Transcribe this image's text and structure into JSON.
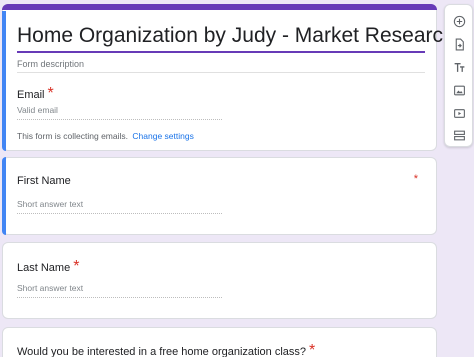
{
  "form": {
    "title": "Home Organization by Judy - Market Research",
    "description_placeholder": "Form description"
  },
  "email_section": {
    "label": "Email",
    "required_mark": "*",
    "placeholder": "Valid email",
    "note": "This form is collecting emails.",
    "change_link": "Change settings"
  },
  "questions": [
    {
      "label": "First Name",
      "required_mark": "*",
      "answer_placeholder": "Short answer text"
    },
    {
      "label": "Last Name",
      "required_mark": "*",
      "answer_placeholder": "Short answer text"
    },
    {
      "label": "Would you be interested in a free home organization class?",
      "required_mark": "*"
    }
  ],
  "toolbar": {
    "items": [
      "add-question-icon",
      "import-questions-icon",
      "add-title-icon",
      "add-image-icon",
      "add-video-icon",
      "add-section-icon"
    ]
  },
  "colors": {
    "theme": "#673ab7",
    "accent": "#4285f4",
    "background": "#ede7f6",
    "required": "#d93025",
    "link": "#1a73e8"
  }
}
